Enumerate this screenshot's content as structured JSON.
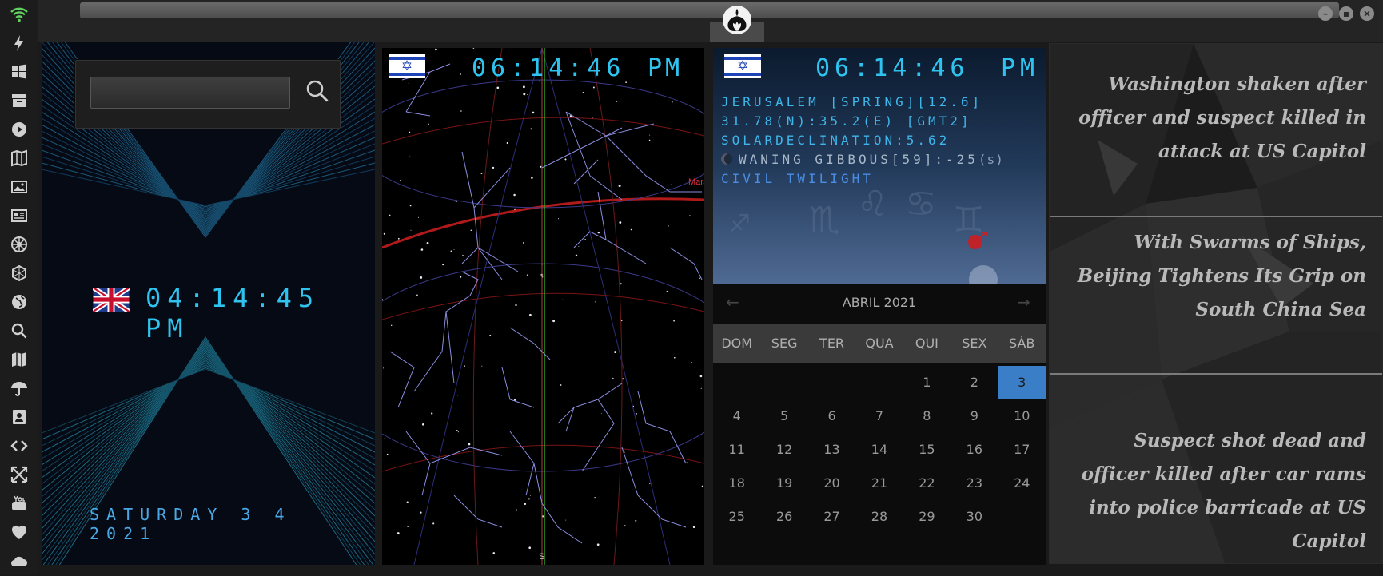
{
  "sidebar": {
    "icons": [
      "wifi-icon",
      "bolt-icon",
      "windows-icon",
      "archive-icon",
      "play-icon",
      "map-book-icon",
      "image-icon",
      "newspaper-icon",
      "rebel-icon",
      "hexagon-icon",
      "globe-icon",
      "search-icon",
      "map-icon",
      "umbrella-icon",
      "contacts-icon",
      "code-icon",
      "expand-icon",
      "youtube-icon",
      "heart-icon",
      "cloud-icon"
    ]
  },
  "world_clock": {
    "search_placeholder": "",
    "uk_time": "04:14:45 PM",
    "date_line": "SATURDAY 3 4 2021"
  },
  "sky_map": {
    "time": "06:14:46",
    "ampm": "PM",
    "planet_label": "Mars",
    "south_label": "S"
  },
  "astro": {
    "time": "06:14:46",
    "ampm": "PM",
    "location": "JERUSALEM [SPRING][12.6]",
    "coords": "31.78(N):35.2(E) [GMT2]",
    "declination": "SOLARDECLINATION:5.62",
    "moon": "WANING GIBBOUS[59]:-25",
    "moon_suffix": "(s)",
    "twilight": "CIVIL TWILIGHT"
  },
  "calendar": {
    "title": "ABRIL 2021",
    "prev": "←",
    "next": "→",
    "days_of_week": [
      "DOM",
      "SEG",
      "TER",
      "QUA",
      "QUI",
      "SEX",
      "SÁB"
    ],
    "weeks": [
      [
        "",
        "",
        "",
        "",
        "1",
        "2",
        "3"
      ],
      [
        "4",
        "5",
        "6",
        "7",
        "8",
        "9",
        "10"
      ],
      [
        "11",
        "12",
        "13",
        "14",
        "15",
        "16",
        "17"
      ],
      [
        "18",
        "19",
        "20",
        "21",
        "22",
        "23",
        "24"
      ],
      [
        "25",
        "26",
        "27",
        "28",
        "29",
        "30",
        ""
      ]
    ],
    "today": "3"
  },
  "news": {
    "items": [
      "Washington shaken after officer and suspect killed in attack at US Capitol",
      "With Swarms of Ships, Beijing Tightens Its Grip on South China Sea",
      "Suspect shot dead and officer killed after car rams into police barricade at US Capitol"
    ]
  },
  "colors": {
    "digital": "#2fc4f0",
    "calendar_today": "#3a7ec8"
  }
}
